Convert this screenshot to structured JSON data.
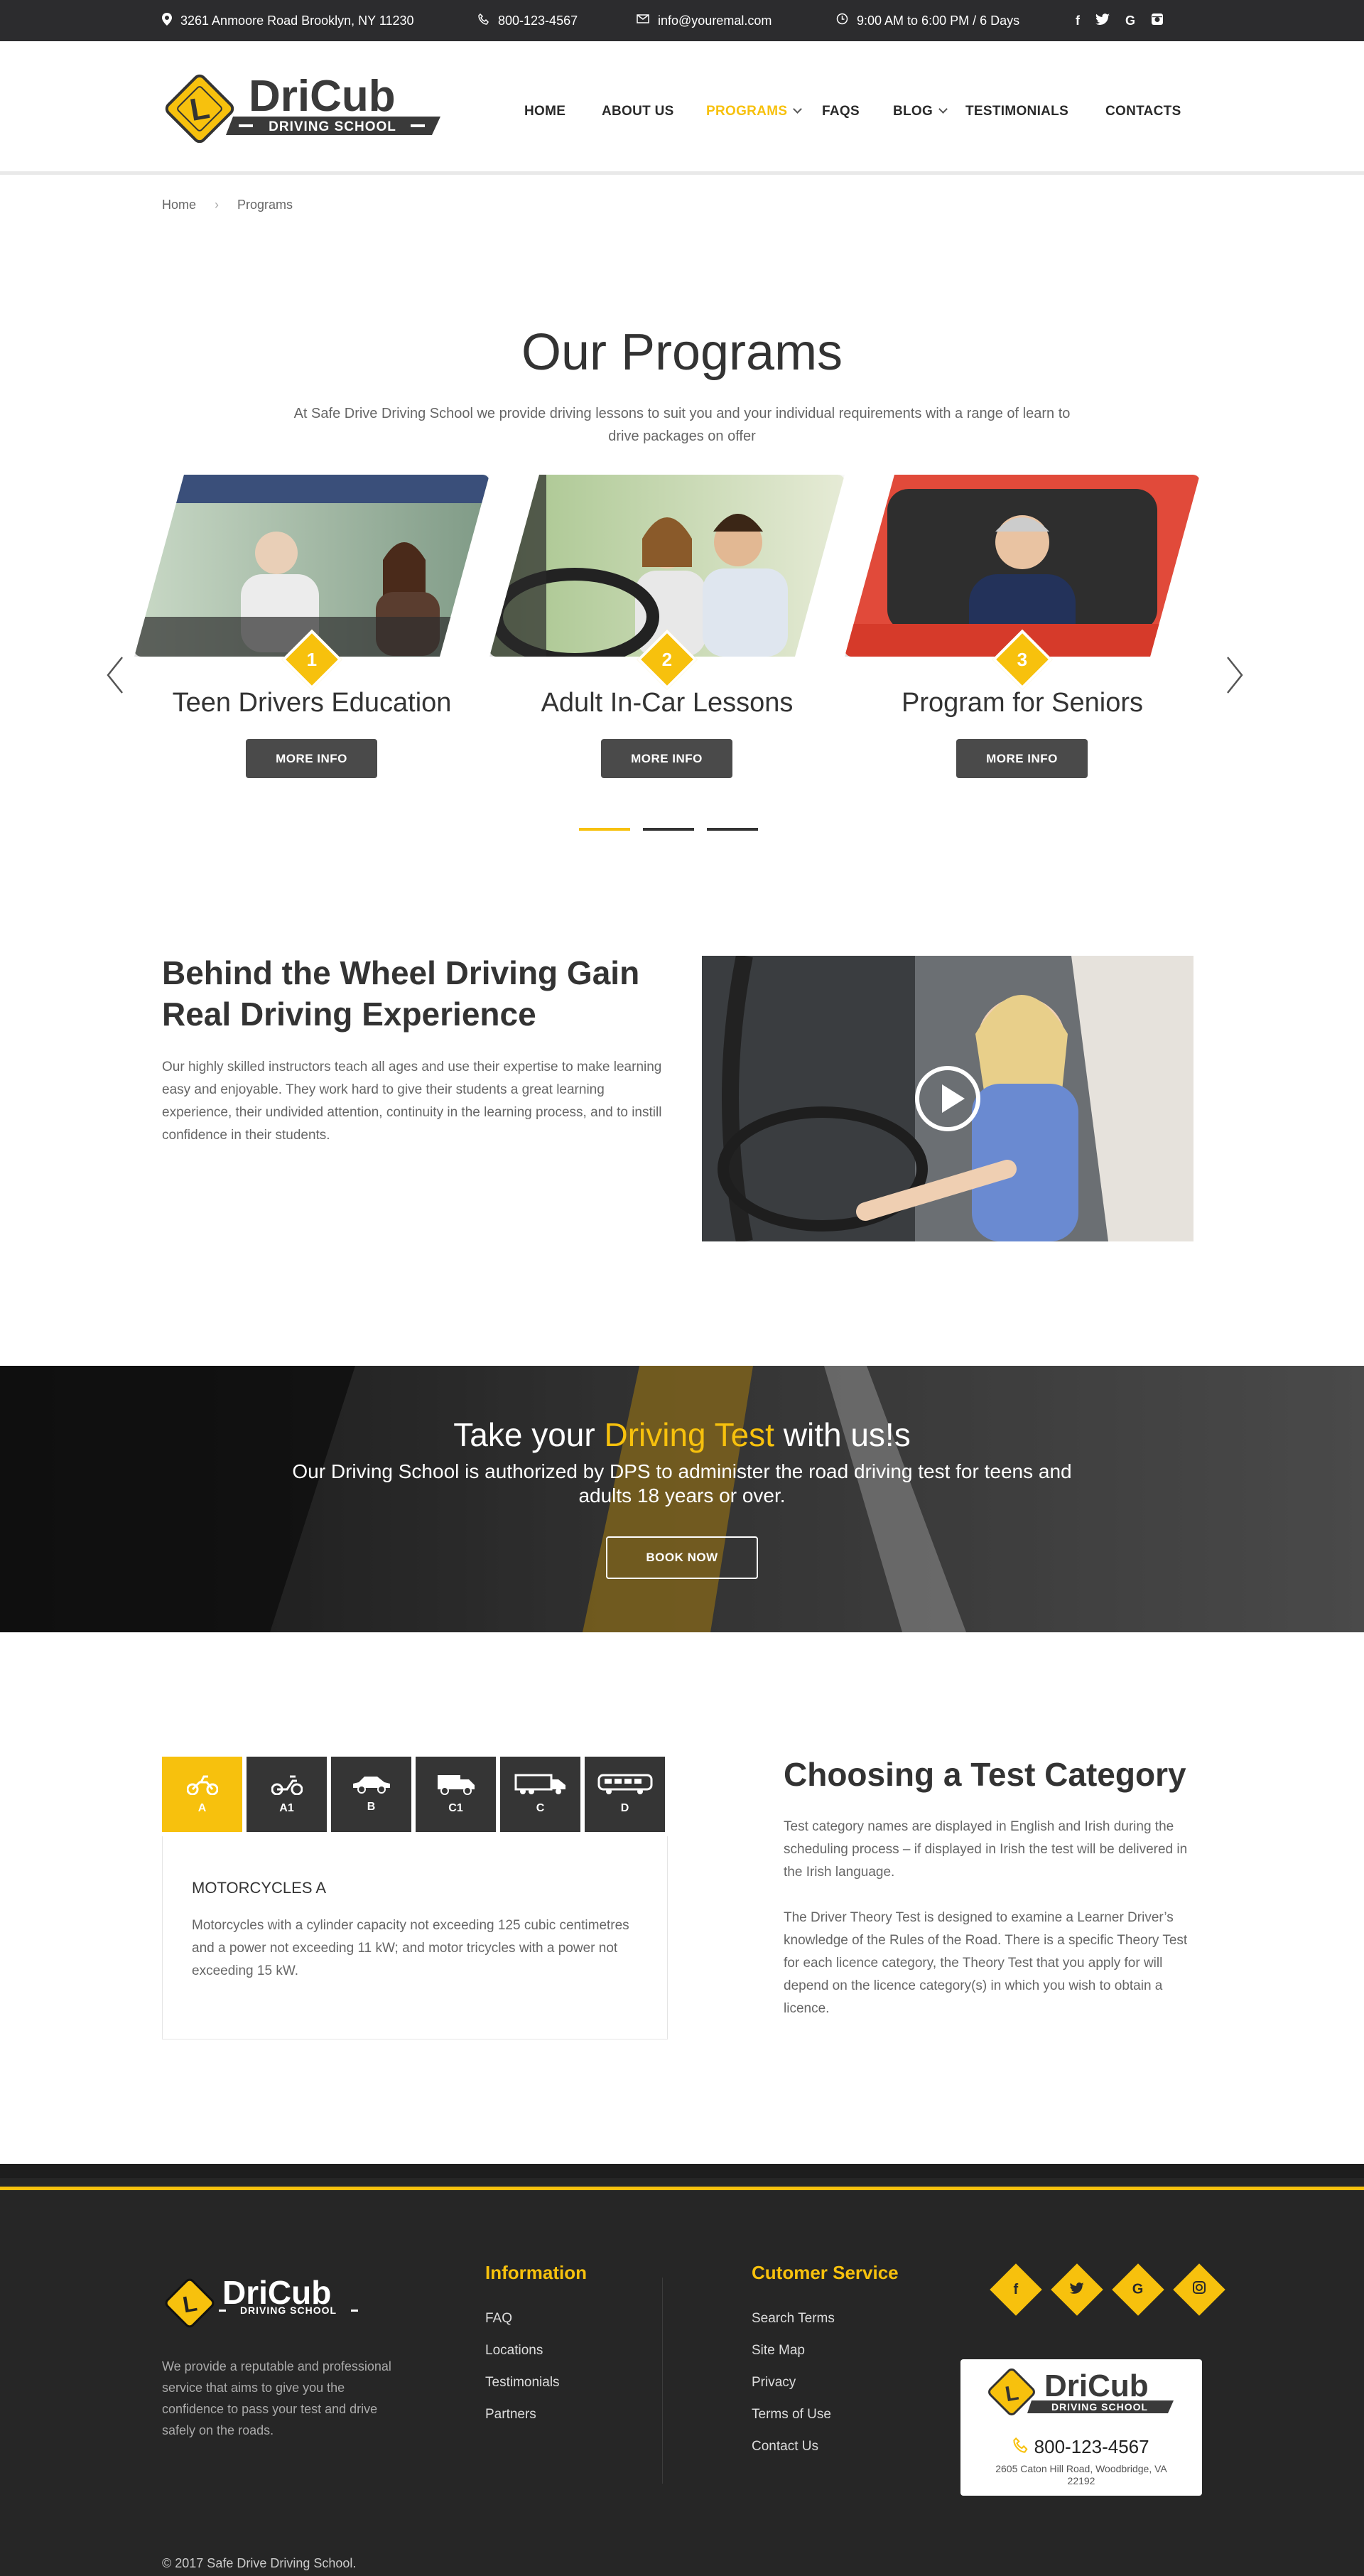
{
  "topbar": {
    "address": "3261 Anmoore Road Brooklyn, NY 11230",
    "phone": "800-123-4567",
    "email": "info@youremal.com",
    "hours": "9:00 AM to 6:00 PM / 6 Days",
    "social": [
      "f",
      "t",
      "G",
      "ig"
    ]
  },
  "brand": {
    "name": "DriCub",
    "tagline": "DRIVING SCHOOL",
    "accent": "#f7c10d",
    "dark": "#2c2c2e"
  },
  "nav": {
    "home": "HOME",
    "about": "ABOUT US",
    "programs": "PROGRAMS",
    "faqs": "FAQS",
    "blog": "BLOG",
    "testimonials": "TESTIMONIALS",
    "contacts": "CONTACTS"
  },
  "breadcrumb": {
    "home": "Home",
    "current": "Programs"
  },
  "programs": {
    "title": "Our Programs",
    "lead": "At Safe Drive Driving School we provide driving lessons to suit you and your individual requirements with a range of learn to drive packages on offer",
    "items": [
      {
        "num": "1",
        "title": "Teen Drivers Education",
        "button": "MORE INFO"
      },
      {
        "num": "2",
        "title": "Adult In-Car Lessons",
        "button": "MORE INFO"
      },
      {
        "num": "3",
        "title": "Program for Seniors",
        "button": "MORE INFO"
      }
    ]
  },
  "behind": {
    "title": "Behind the Wheel Driving Gain Real Driving Experience",
    "text": "Our highly skilled instructors teach all ages and use their expertise to make learning easy and enjoyable. They work hard to give their students a great learning experience, their undivided attention, continuity in the learning process, and to instill confidence in their students."
  },
  "banner": {
    "title_pre": "Take your ",
    "title_hl": "Driving Test",
    "title_post": " with us!s",
    "subtitle": "Our Driving School is authorized by DPS to administer the road driving test for teens and adults 18 years or over.",
    "button": "BOOK NOW"
  },
  "categories": {
    "tabs": [
      "A",
      "A1",
      "B",
      "C1",
      "C",
      "D"
    ],
    "panel_title": "MOTORCYCLES A",
    "panel_text": "Motorcycles with a cylinder capacity not exceeding 125 cubic centimetres and a power not exceeding 11 kW; and motor tricycles with a power not exceeding 15 kW.",
    "title": "Choosing a Test Category",
    "p1": "Test category names are displayed in English and Irish during the scheduling process – if displayed in Irish the test will be delivered in the Irish language.",
    "p2": "The Driver Theory Test is designed to examine a Learner Driver’s knowledge of the Rules of the Road. There is a specific Theory Test for each licence category, the Theory Test that you apply for will depend on the licence category(s) in which you wish to obtain a licence."
  },
  "footer": {
    "desc": "We provide a reputable and professional service that aims to give you the confidence to pass your test and drive safely on the roads.",
    "info_title": "Information",
    "info_links": [
      "FAQ",
      "Locations",
      "Testimonials",
      "Partners"
    ],
    "service_title": "Cutomer Service",
    "service_links": [
      "Search Terms",
      "Site Map",
      "Privacy",
      "Terms of Use",
      "Contact Us"
    ],
    "social": [
      "f",
      "t",
      "G",
      "ig"
    ],
    "phone": "800-123-4567",
    "address": "2605 Caton Hill Road, Woodbridge, VA 22192",
    "copyright": "© 2017 Safe Drive Driving School."
  }
}
